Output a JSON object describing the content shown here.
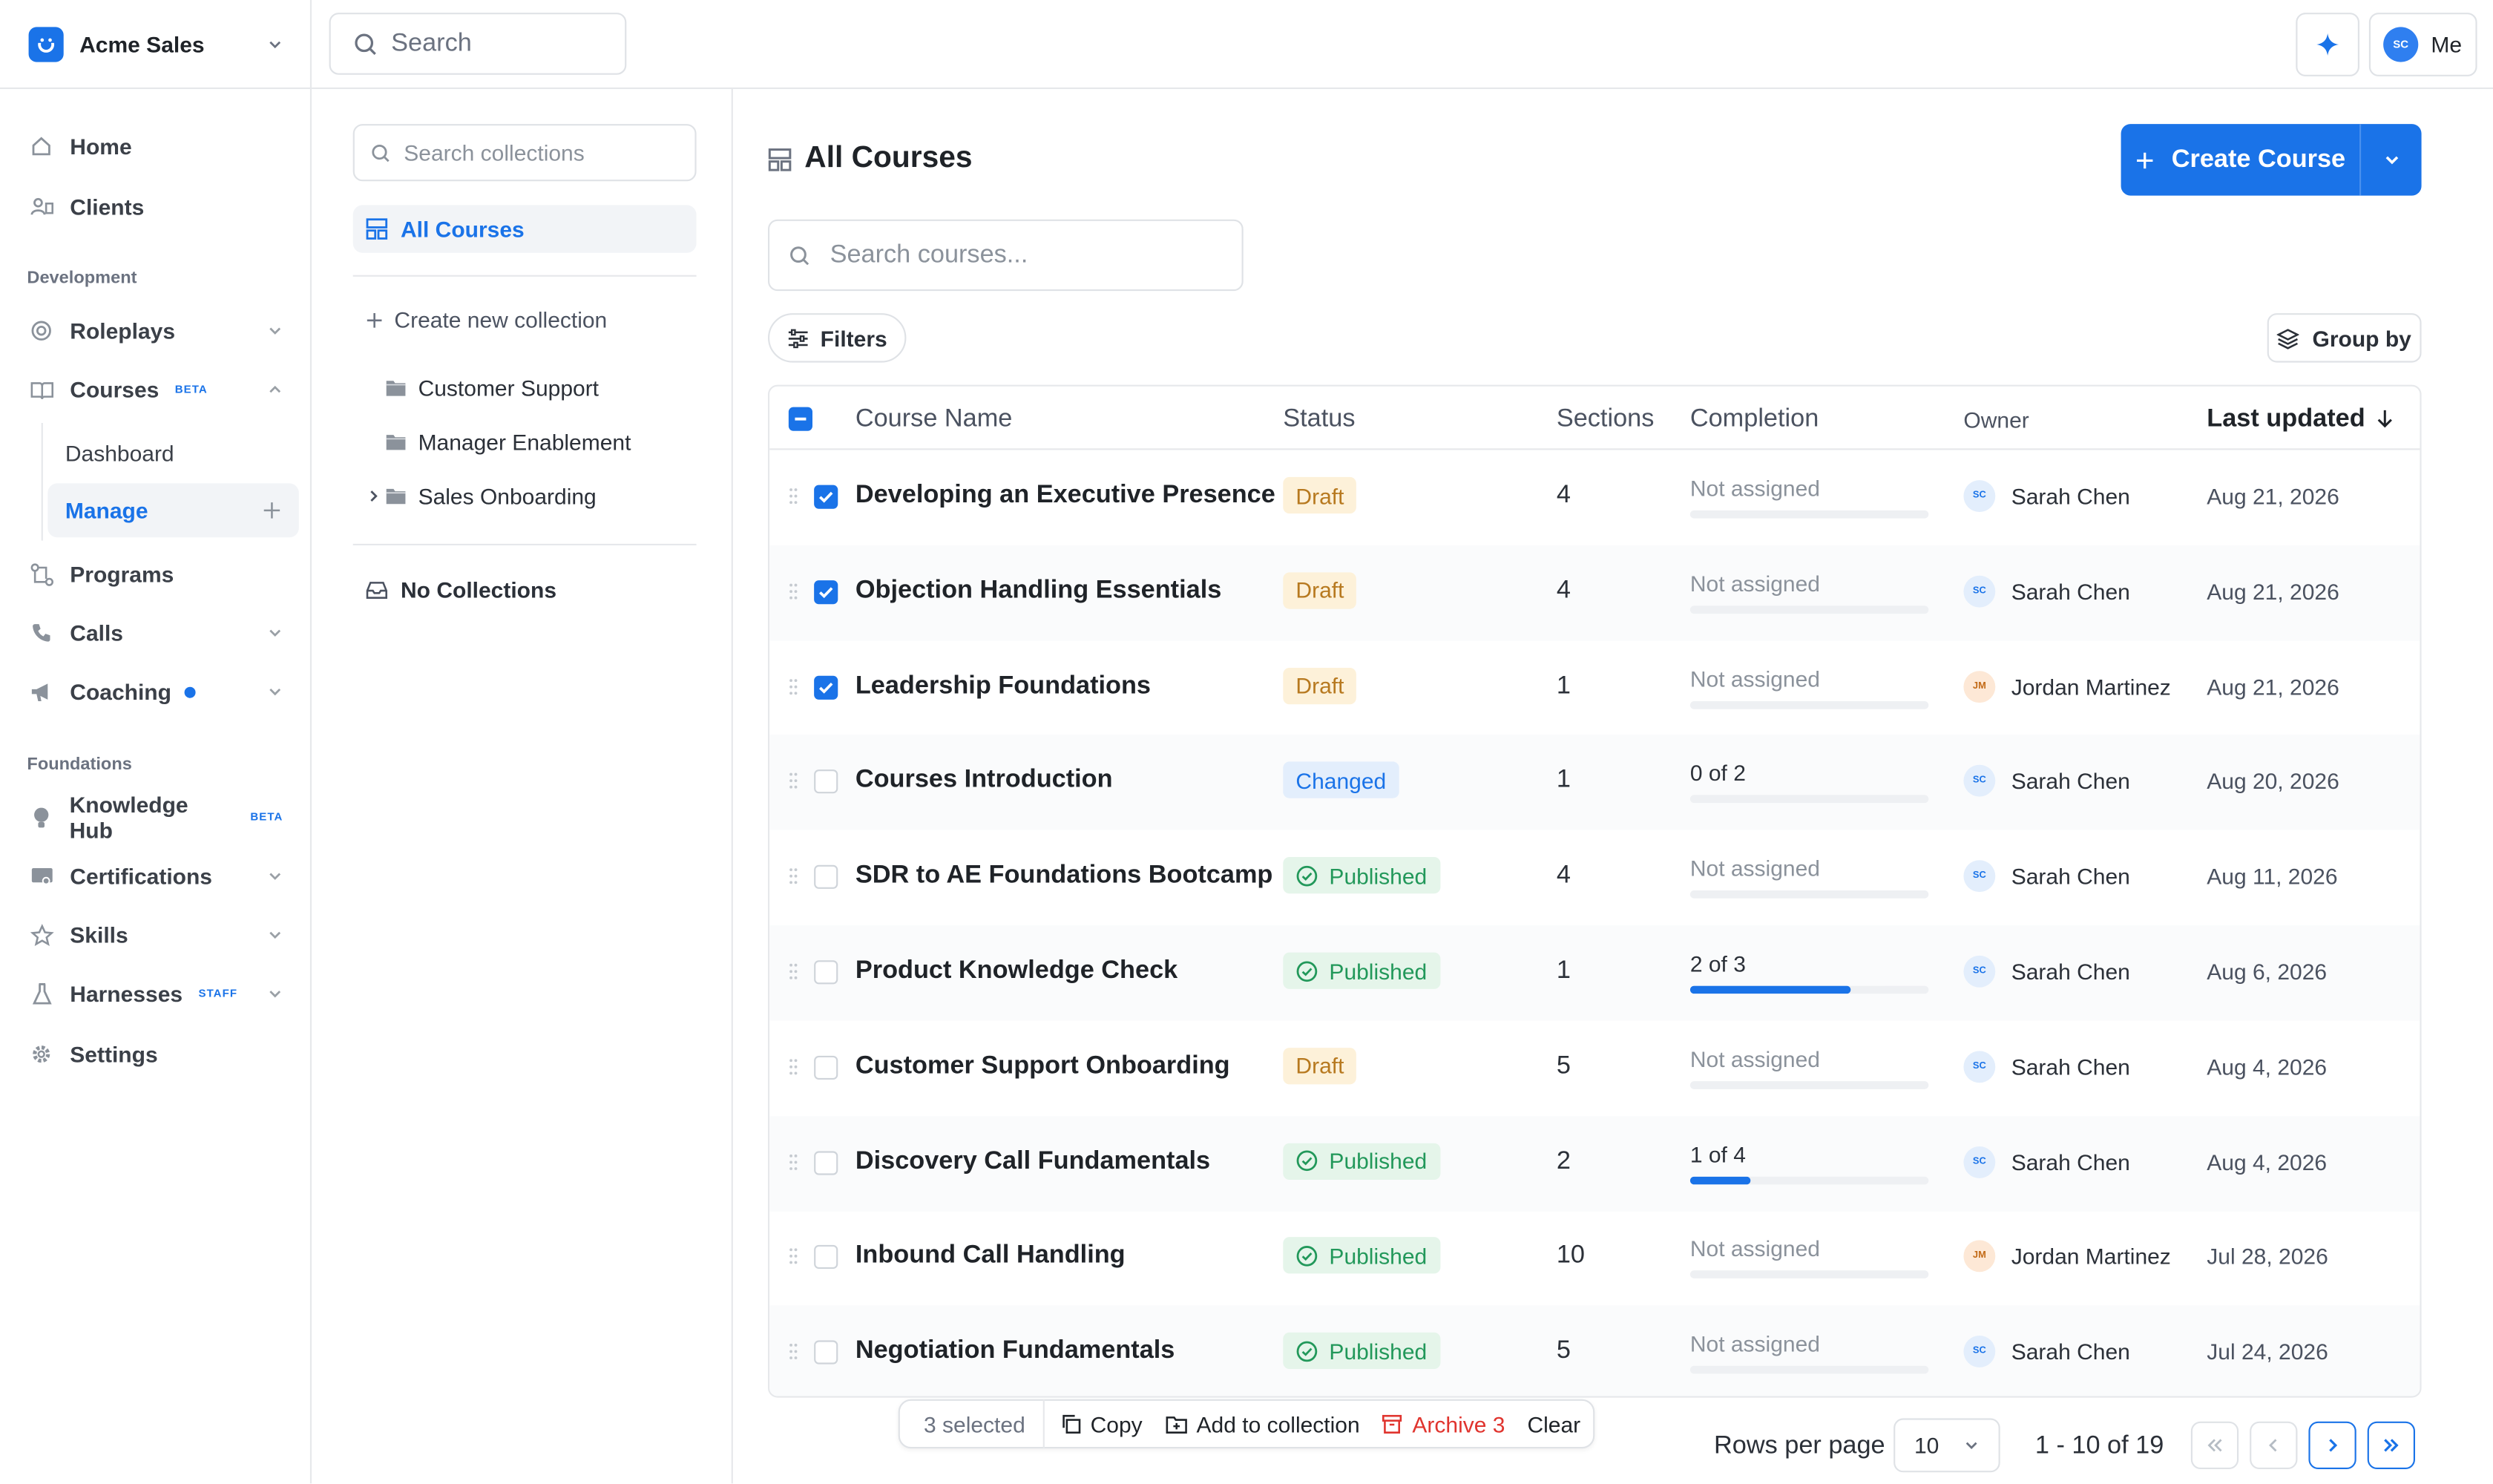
{
  "sidebar": {
    "org_name": "Acme Sales",
    "items_top": [
      {
        "label": "Home",
        "icon": "home-icon"
      },
      {
        "label": "Clients",
        "icon": "clients-icon"
      }
    ],
    "section_development": "Development",
    "roleplays": "Roleplays",
    "courses": "Courses",
    "courses_badge": "BETA",
    "courses_sub": [
      {
        "label": "Dashboard"
      },
      {
        "label": "Manage"
      }
    ],
    "programs": "Programs",
    "calls": "Calls",
    "coaching": "Coaching",
    "section_foundations": "Foundations",
    "knowledge_hub": "Knowledge Hub",
    "knowledge_hub_badge": "BETA",
    "certifications": "Certifications",
    "skills": "Skills",
    "harnesses": "Harnesses",
    "harnesses_badge": "STAFF",
    "settings": "Settings"
  },
  "topbar": {
    "search_placeholder": "Search",
    "user_initials": "SC",
    "user_label": "Me"
  },
  "collections": {
    "search_placeholder": "Search collections",
    "all_courses": "All Courses",
    "create_new": "Create new collection",
    "folders": [
      {
        "label": "Customer Support"
      },
      {
        "label": "Manager Enablement"
      },
      {
        "label": "Sales Onboarding"
      }
    ],
    "no_collections": "No Collections"
  },
  "main": {
    "title": "All Courses",
    "create_button": "Create Course",
    "search_placeholder": "Search courses...",
    "filters": "Filters",
    "group_by": "Group by"
  },
  "table": {
    "headers": {
      "name": "Course Name",
      "status": "Status",
      "sections": "Sections",
      "completion": "Completion",
      "owner": "Owner",
      "updated": "Last updated"
    },
    "rows": [
      {
        "name": "Developing an Executive Presence",
        "status": "Draft",
        "sections": "4",
        "completion": "Not assigned",
        "progress": 0,
        "owner": "Sarah Chen",
        "initials": "SC",
        "updated": "Aug 21, 2026",
        "checked": true
      },
      {
        "name": "Objection Handling Essentials",
        "status": "Draft",
        "sections": "4",
        "completion": "Not assigned",
        "progress": 0,
        "owner": "Sarah Chen",
        "initials": "SC",
        "updated": "Aug 21, 2026",
        "checked": true
      },
      {
        "name": "Leadership Foundations",
        "status": "Draft",
        "sections": "1",
        "completion": "Not assigned",
        "progress": 0,
        "owner": "Jordan Martinez",
        "initials": "JM",
        "updated": "Aug 21, 2026",
        "checked": true
      },
      {
        "name": "Courses Introduction",
        "status": "Changed",
        "sections": "1",
        "completion": "0 of 2",
        "progress": 0,
        "owner": "Sarah Chen",
        "initials": "SC",
        "updated": "Aug 20, 2026",
        "checked": false
      },
      {
        "name": "SDR to AE Foundations Bootcamp",
        "status": "Published",
        "sections": "4",
        "completion": "Not assigned",
        "progress": 0,
        "owner": "Sarah Chen",
        "initials": "SC",
        "updated": "Aug 11, 2026",
        "checked": false
      },
      {
        "name": "Product Knowledge Check",
        "status": "Published",
        "sections": "1",
        "completion": "2 of 3",
        "progress": 0.667,
        "owner": "Sarah Chen",
        "initials": "SC",
        "updated": "Aug 6, 2026",
        "checked": false
      },
      {
        "name": "Customer Support Onboarding",
        "status": "Draft",
        "sections": "5",
        "completion": "Not assigned",
        "progress": 0,
        "owner": "Sarah Chen",
        "initials": "SC",
        "updated": "Aug 4, 2026",
        "checked": false
      },
      {
        "name": "Discovery Call Fundamentals",
        "status": "Published",
        "sections": "2",
        "completion": "1 of 4",
        "progress": 0.25,
        "owner": "Sarah Chen",
        "initials": "SC",
        "updated": "Aug 4, 2026",
        "checked": false
      },
      {
        "name": "Inbound Call Handling",
        "status": "Published",
        "sections": "10",
        "completion": "Not assigned",
        "progress": 0,
        "owner": "Jordan Martinez",
        "initials": "JM",
        "updated": "Jul 28, 2026",
        "checked": false
      },
      {
        "name": "Negotiation Fundamentals",
        "status": "Published",
        "sections": "5",
        "completion": "Not assigned",
        "progress": 0,
        "owner": "Sarah Chen",
        "initials": "SC",
        "updated": "Jul 24, 2026",
        "checked": false
      }
    ]
  },
  "bulk": {
    "selected": "3 selected",
    "copy": "Copy",
    "add_to_collection": "Add to collection",
    "archive": "Archive 3",
    "clear": "Clear"
  },
  "pagination": {
    "rows_per_page_label": "Rows per page",
    "rows_per_page": "10",
    "range": "1 - 10 of 19"
  },
  "colors": {
    "accent": "#1a73e8",
    "draft": "#b7791f",
    "published": "#22985a",
    "danger": "#e0342e"
  }
}
